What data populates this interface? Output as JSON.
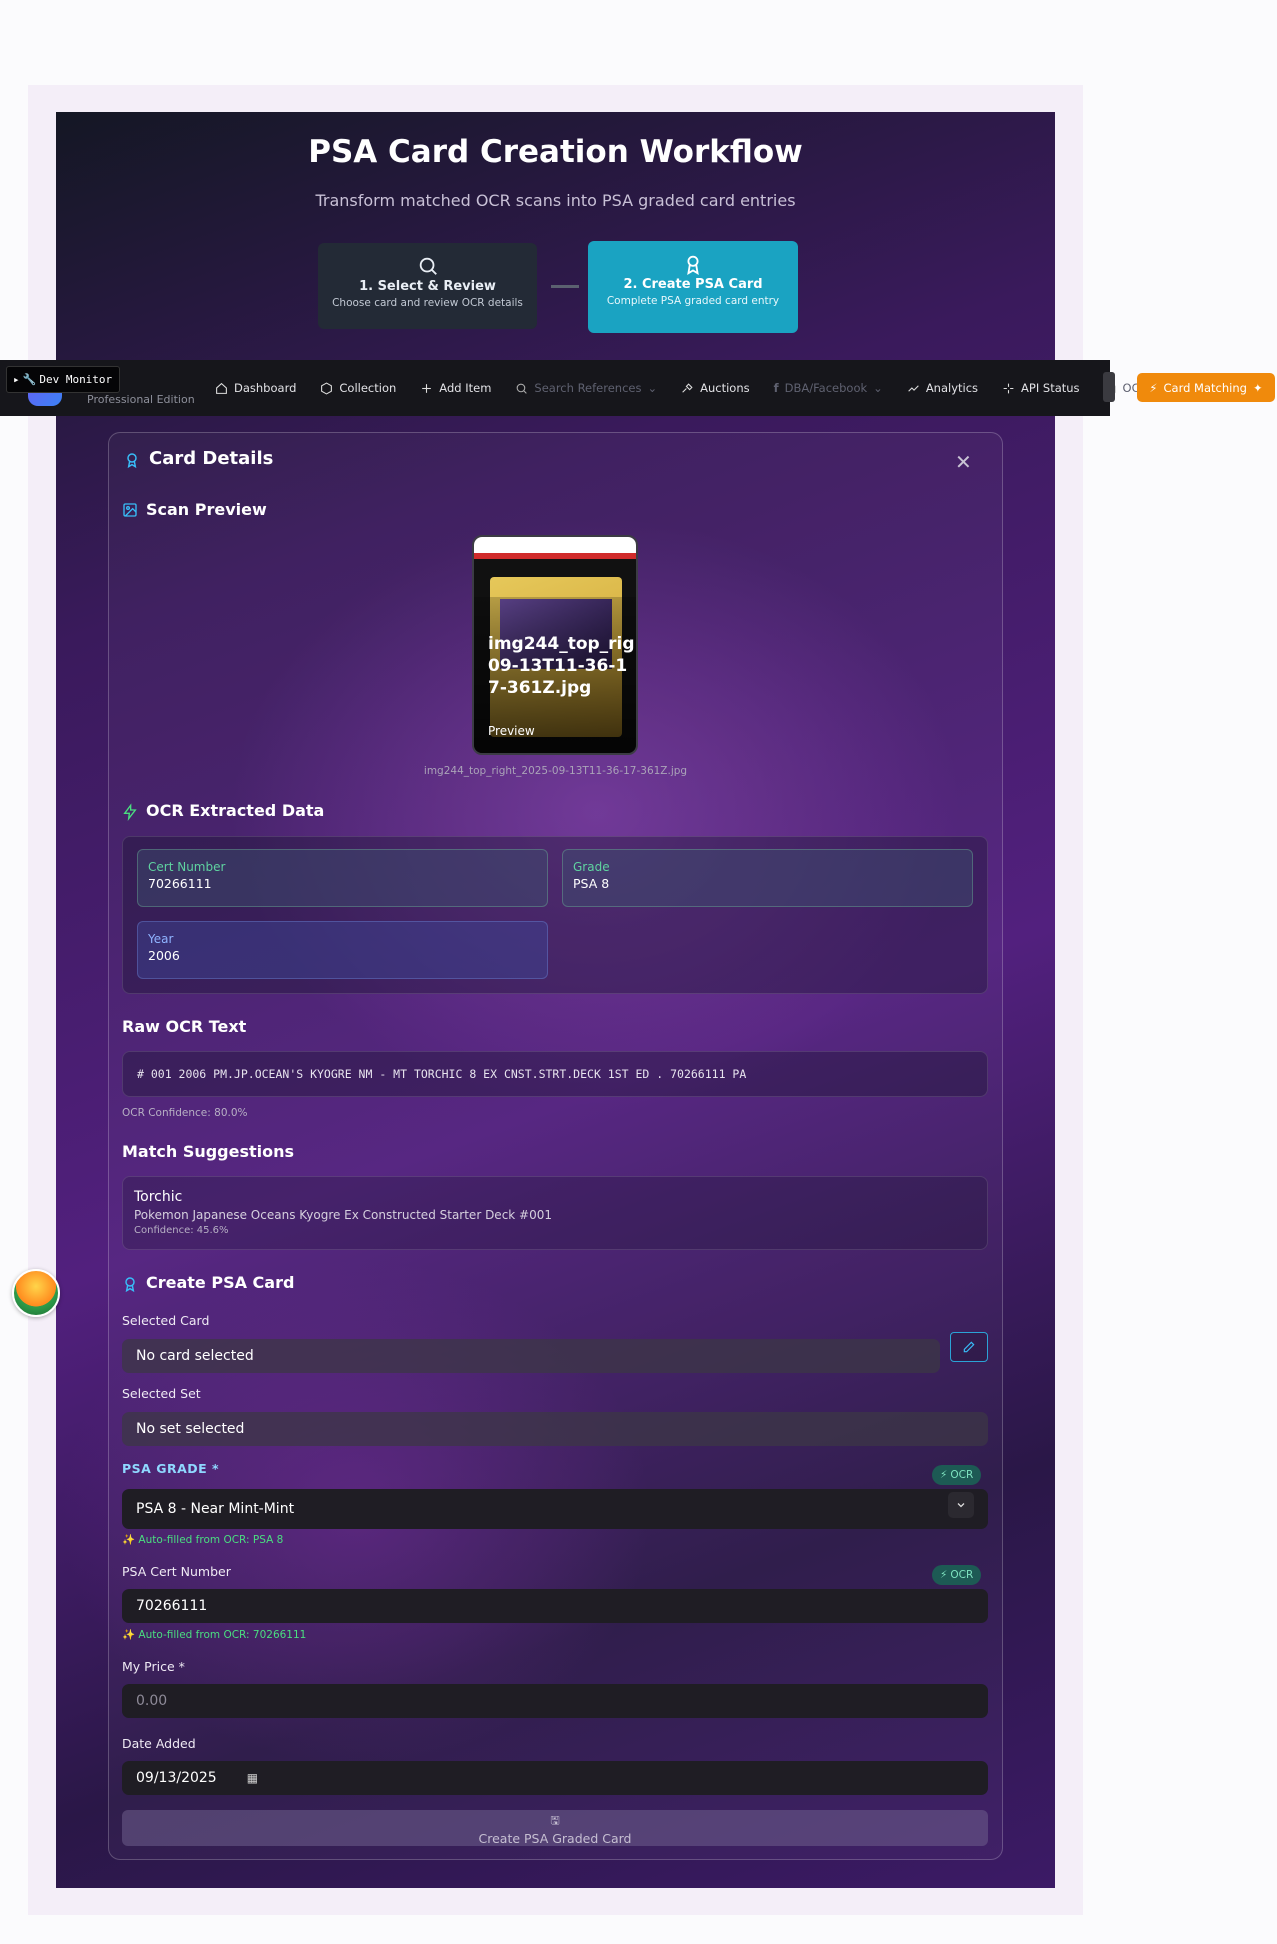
{
  "workflow": {
    "title": "PSA Card Creation Workflow",
    "subtitle": "Transform matched OCR scans into PSA graded card entries",
    "steps": [
      {
        "title": "1. Select & Review",
        "desc": "Choose card and review OCR details"
      },
      {
        "title": "2. Create PSA Card",
        "desc": "Complete PSA graded card entry"
      }
    ]
  },
  "nav": {
    "dev_monitor": "Dev Monitor",
    "brand_edition": "Professional Edition",
    "items": [
      {
        "label": "Dashboard",
        "icon": "home-icon"
      },
      {
        "label": "Collection",
        "icon": "box-icon"
      },
      {
        "label": "Add Item",
        "icon": "plus-icon"
      },
      {
        "label": "Search References",
        "icon": "search-icon"
      },
      {
        "label": "Auctions",
        "icon": "gavel-icon"
      },
      {
        "label": "DBA/Facebook",
        "icon": "facebook-icon"
      },
      {
        "label": "Analytics",
        "icon": "trending-icon"
      },
      {
        "label": "API Status",
        "icon": "sparkle-icon"
      },
      {
        "label": "OCR",
        "icon": "camera-icon"
      }
    ],
    "card_matching": "Card Matching"
  },
  "details": {
    "title": "Card Details",
    "scan_preview": "Scan Preview",
    "preview_name": "img244_top_right_2025-09-13T11-36-17-361Z.jpg",
    "preview_overlay": "img244_top_rig 09-13T11-36-17-361Z.jpg",
    "preview_label": "Preview",
    "ocr_title": "OCR Extracted Data",
    "cert_label": "Cert Number",
    "cert_value": "70266111",
    "grade_label": "Grade",
    "grade_value": "PSA 8",
    "year_label": "Year",
    "year_value": "2006",
    "raw_title": "Raw OCR Text",
    "raw_text": "# 001 2006 PM.JP.OCEAN'S KYOGRE NM - MT TORCHIC 8 EX CNST.STRT.DECK 1ST ED . 70266111 PA",
    "confidence": "OCR Confidence: 80.0%",
    "match_title": "Match Suggestions",
    "match_name": "Torchic",
    "match_set": "Pokemon Japanese Oceans Kyogre Ex Constructed Starter Deck #001",
    "match_conf": "Confidence: 45.6%"
  },
  "form": {
    "title": "Create PSA Card",
    "selected_card_label": "Selected Card",
    "selected_card_value": "No card selected",
    "selected_set_label": "Selected Set",
    "selected_set_value": "No set selected",
    "grade_label": "PSA GRADE *",
    "ocr_badge": "OCR",
    "grade_value": "PSA 8 - Near Mint-Mint",
    "grade_auto": "✨ Auto-filled from OCR: PSA 8",
    "cert_label": "PSA Cert Number",
    "cert_value": "70266111",
    "cert_auto": "✨ Auto-filled from OCR: 70266111",
    "price_label": "My Price *",
    "price_placeholder": "0.00",
    "date_label": "Date Added",
    "date_value": "09/13/2025",
    "submit": "Create PSA Graded Card"
  }
}
